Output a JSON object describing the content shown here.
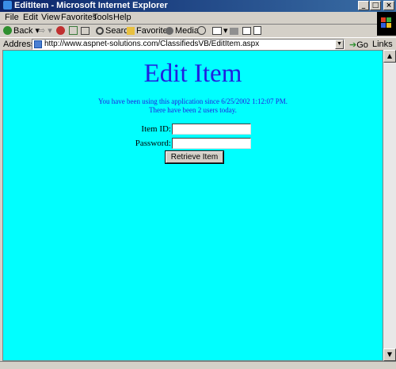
{
  "window": {
    "title": "EditItem - Microsoft Internet Explorer",
    "minimize_glyph": "_",
    "maximize_glyph": "□",
    "close_glyph": "×"
  },
  "menu": [
    "File",
    "Edit",
    "View",
    "Favorites",
    "Tools",
    "Help"
  ],
  "toolbar": {
    "back": "Back",
    "forward_glyph": "⇨",
    "search": "Search",
    "favorites": "Favorites",
    "media": "Media"
  },
  "address": {
    "label": "Address",
    "url": "http://www.aspnet-solutions.com/ClassifiedsVB/EditItem.aspx",
    "go": "Go",
    "links": "Links"
  },
  "page": {
    "heading": "Edit Item",
    "usage_line1": "You have been using this application since 6/25/2002 1:12:07 PM.",
    "usage_line2": "There have been 2 users today.",
    "item_id_label": "Item ID:",
    "item_id_value": "",
    "password_label": "Password:",
    "password_value": "",
    "retrieve_button": "Retrieve Item"
  },
  "colors": {
    "page_background": "#00ffff",
    "heading_text": "#2020e0",
    "title_bar": "#0a246a"
  },
  "icons": [
    "ie-logo-icon",
    "back-arrow-icon",
    "forward-arrow-icon",
    "stop-icon",
    "refresh-icon",
    "home-icon",
    "search-icon",
    "favorites-icon",
    "media-icon",
    "history-icon",
    "mail-icon",
    "print-icon",
    "edit-icon",
    "page-icon",
    "go-arrow-icon",
    "windows-logo-icon"
  ]
}
